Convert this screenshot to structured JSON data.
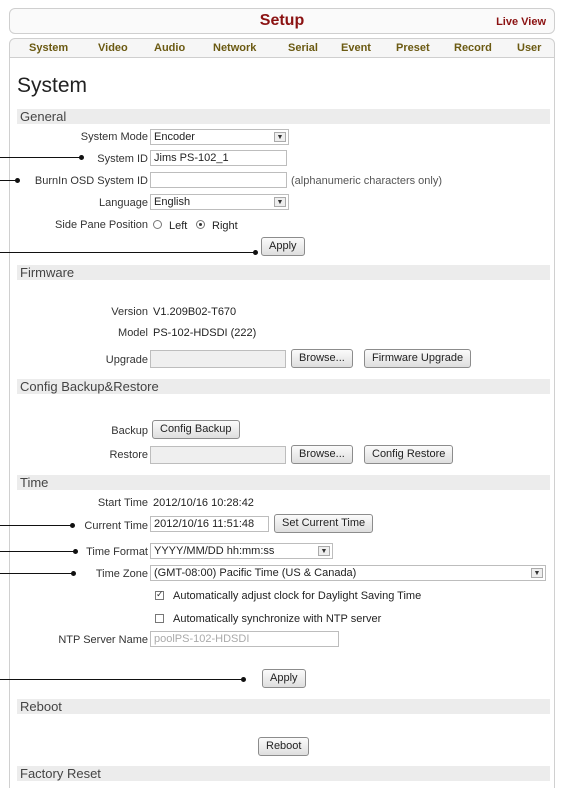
{
  "header": {
    "title": "Setup",
    "live_view": "Live View"
  },
  "tabs": [
    "System",
    "Video",
    "Audio",
    "Network",
    "Serial",
    "Event",
    "Preset",
    "Record",
    "User"
  ],
  "page_title": "System",
  "general": {
    "section": "General",
    "system_mode_label": "System Mode",
    "system_mode_value": "Encoder",
    "system_id_label": "System ID",
    "system_id_value": "Jims PS-102_1",
    "burnin_label": "BurnIn OSD System ID",
    "burnin_value": "",
    "burnin_hint": "(alphanumeric characters only)",
    "language_label": "Language",
    "language_value": "English",
    "side_pane_label": "Side Pane Position",
    "side_pane_left": "Left",
    "side_pane_right": "Right",
    "apply": "Apply"
  },
  "firmware": {
    "section": "Firmware",
    "version_label": "Version",
    "version_value": "V1.209B02-T670",
    "model_label": "Model",
    "model_value": "PS-102-HDSDI (222)",
    "upgrade_label": "Upgrade",
    "browse": "Browse...",
    "upgrade_button": "Firmware Upgrade"
  },
  "config": {
    "section": "Config Backup&Restore",
    "backup_label": "Backup",
    "backup_button": "Config Backup",
    "restore_label": "Restore",
    "browse": "Browse...",
    "restore_button": "Config Restore"
  },
  "time": {
    "section": "Time",
    "start_label": "Start Time",
    "start_value": "2012/10/16 10:28:42",
    "current_label": "Current Time",
    "current_value": "2012/10/16 11:51:48",
    "set_current": "Set Current Time",
    "format_label": "Time Format",
    "format_value": "YYYY/MM/DD hh:mm:ss",
    "zone_label": "Time Zone",
    "zone_value": "(GMT-08:00) Pacific Time (US & Canada)",
    "dst_label": "Automatically adjust clock for Daylight Saving Time",
    "ntp_sync_label": "Automatically synchronize with NTP server",
    "ntp_server_label": "NTP Server Name",
    "ntp_server_value": "poolPS-102-HDSDI",
    "apply": "Apply"
  },
  "reboot": {
    "section": "Reboot",
    "button": "Reboot"
  },
  "factory": {
    "section": "Factory Reset"
  }
}
